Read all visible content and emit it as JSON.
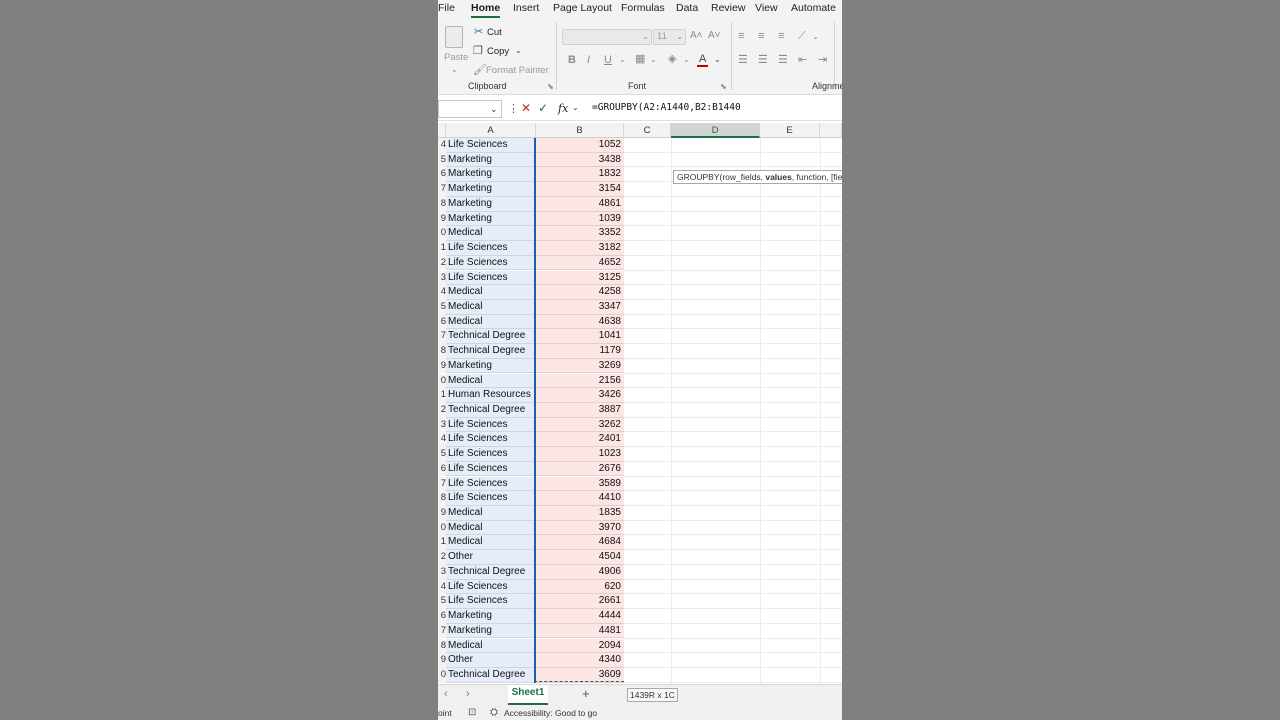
{
  "ribbon_tabs": [
    "File",
    "Home",
    "Insert",
    "Page Layout",
    "Formulas",
    "Data",
    "Review",
    "View",
    "Automate"
  ],
  "active_tab": "Home",
  "clipboard": {
    "paste": "Paste",
    "cut": "Cut",
    "copy": "Copy",
    "format_painter": "Format Painter",
    "group": "Clipboard"
  },
  "font": {
    "size": "11",
    "group": "Font"
  },
  "alignment": {
    "group": "Alignme"
  },
  "formula_bar": {
    "formula": "=GROUPBY(A2:A1440,B2:B1440",
    "fx": "fx"
  },
  "columns": [
    "A",
    "B",
    "C",
    "D",
    "E"
  ],
  "rows": [
    {
      "n": "4",
      "a": "Life Sciences",
      "b": "1052"
    },
    {
      "n": "5",
      "a": "Marketing",
      "b": "3438"
    },
    {
      "n": "6",
      "a": "Marketing",
      "b": "1832"
    },
    {
      "n": "7",
      "a": "Marketing",
      "b": "3154"
    },
    {
      "n": "8",
      "a": "Marketing",
      "b": "4861"
    },
    {
      "n": "9",
      "a": "Marketing",
      "b": "1039"
    },
    {
      "n": "0",
      "a": "Medical",
      "b": "3352"
    },
    {
      "n": "1",
      "a": "Life Sciences",
      "b": "3182"
    },
    {
      "n": "2",
      "a": "Life Sciences",
      "b": "4652"
    },
    {
      "n": "3",
      "a": "Life Sciences",
      "b": "3125"
    },
    {
      "n": "4",
      "a": "Medical",
      "b": "4258"
    },
    {
      "n": "5",
      "a": "Medical",
      "b": "3347"
    },
    {
      "n": "6",
      "a": "Medical",
      "b": "4638"
    },
    {
      "n": "7",
      "a": "Technical Degree",
      "b": "1041"
    },
    {
      "n": "8",
      "a": "Technical Degree",
      "b": "1179"
    },
    {
      "n": "9",
      "a": "Marketing",
      "b": "3269"
    },
    {
      "n": "0",
      "a": "Medical",
      "b": "2156"
    },
    {
      "n": "1",
      "a": "Human Resources",
      "b": "3426"
    },
    {
      "n": "2",
      "a": "Technical Degree",
      "b": "3887"
    },
    {
      "n": "3",
      "a": "Life Sciences",
      "b": "3262"
    },
    {
      "n": "4",
      "a": "Life Sciences",
      "b": "2401"
    },
    {
      "n": "5",
      "a": "Life Sciences",
      "b": "1023"
    },
    {
      "n": "6",
      "a": "Life Sciences",
      "b": "2676"
    },
    {
      "n": "7",
      "a": "Life Sciences",
      "b": "3589"
    },
    {
      "n": "8",
      "a": "Life Sciences",
      "b": "4410"
    },
    {
      "n": "9",
      "a": "Medical",
      "b": "1835"
    },
    {
      "n": "0",
      "a": "Medical",
      "b": "3970"
    },
    {
      "n": "1",
      "a": "Medical",
      "b": "4684"
    },
    {
      "n": "2",
      "a": "Other",
      "b": "4504"
    },
    {
      "n": "3",
      "a": "Technical Degree",
      "b": "4906"
    },
    {
      "n": "4",
      "a": "Life Sciences",
      "b": "620"
    },
    {
      "n": "5",
      "a": "Life Sciences",
      "b": "2661"
    },
    {
      "n": "6",
      "a": "Marketing",
      "b": "4444"
    },
    {
      "n": "7",
      "a": "Marketing",
      "b": "4481"
    },
    {
      "n": "8",
      "a": "Medical",
      "b": "2094"
    },
    {
      "n": "9",
      "a": "Other",
      "b": "4340"
    },
    {
      "n": "0",
      "a": "Technical Degree",
      "b": "3609"
    }
  ],
  "tooltip": {
    "func": "GROUPBY(row_fields, ",
    "arg": "values",
    "rest": ", function, [fie"
  },
  "sheet_tab": "Sheet1",
  "selection_size": "1439R x 1C",
  "status": {
    "left": "oint",
    "accessibility": "Accessibility: Good to go"
  },
  "colors": {
    "accent": "#1f6e43",
    "col_a_fill": "#e5eef8",
    "col_b_fill": "#fbe5e5"
  }
}
